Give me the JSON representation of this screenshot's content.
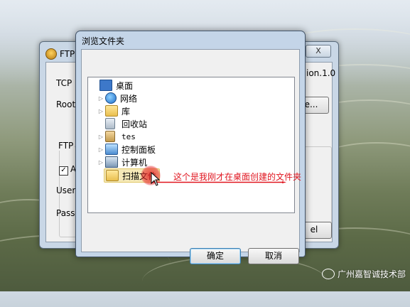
{
  "back_window": {
    "title": "FTP",
    "close_label": "X",
    "version_text": "ion.1.0",
    "tcp_label": "TCP",
    "root_label": "Root",
    "browse_label": "e...",
    "group_label": "FTP",
    "checkbox_label": "A",
    "user_label": "User",
    "pass_label": "Pass",
    "bottom_button_label": "el"
  },
  "dialog": {
    "title": "浏览文件夹",
    "tree": [
      {
        "label": "桌面",
        "icon": "desktop-icon",
        "expander": ""
      },
      {
        "label": "网络",
        "icon": "network-icon",
        "expander": "▷"
      },
      {
        "label": "库",
        "icon": "library-icon",
        "expander": "▷"
      },
      {
        "label": "回收站",
        "icon": "recycle-bin-icon",
        "expander": ""
      },
      {
        "label": "tes",
        "icon": "user-folder-icon",
        "expander": "▷"
      },
      {
        "label": "控制面板",
        "icon": "control-panel-icon",
        "expander": "▷"
      },
      {
        "label": "计算机",
        "icon": "computer-icon",
        "expander": "▷"
      },
      {
        "label": "扫描文件",
        "icon": "folder-icon",
        "expander": ""
      }
    ],
    "ok_label": "确定",
    "cancel_label": "取消"
  },
  "annotation": {
    "text": "这个是我刚才在桌面创建的文件夹",
    "color": "#e0141e"
  },
  "watermark": {
    "text": "广州嘉智诚技术部"
  }
}
